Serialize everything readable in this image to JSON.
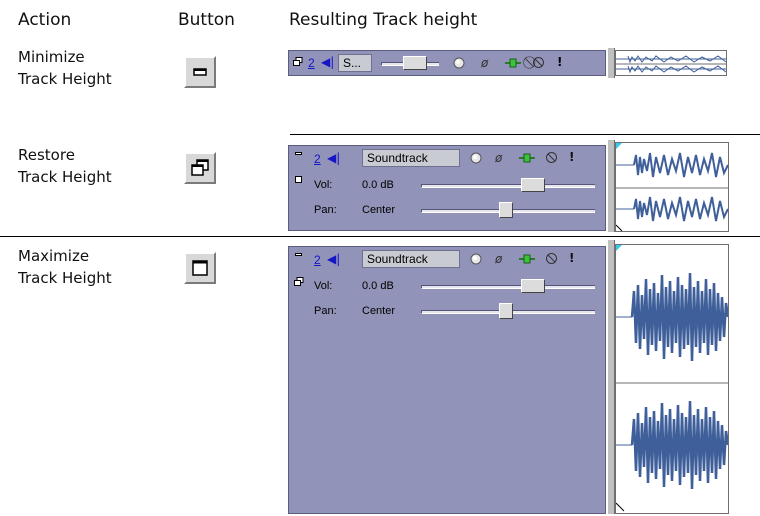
{
  "headers": {
    "action": "Action",
    "button": "Button",
    "result": "Resulting Track height"
  },
  "rows": [
    {
      "action_line1": "Minimize",
      "action_line2": "Track Height",
      "button_icon": "minimize-icon",
      "track": {
        "number": "2",
        "name": "S..."
      }
    },
    {
      "action_line1": "Restore",
      "action_line2": "Track Height",
      "button_icon": "restore-icon",
      "track": {
        "number": "2",
        "name": "Soundtrack",
        "vol_label": "Vol:",
        "vol_value": "0.0 dB",
        "pan_label": "Pan:",
        "pan_value": "Center"
      }
    },
    {
      "action_line1": "Maximize",
      "action_line2": "Track Height",
      "button_icon": "maximize-icon",
      "track": {
        "number": "2",
        "name": "Soundtrack",
        "vol_label": "Vol:",
        "vol_value": "0.0 dB",
        "pan_label": "Pan:",
        "pan_value": "Center"
      }
    }
  ],
  "colors": {
    "panel": "#9293b8",
    "waveform": "#3f5f9a",
    "track_number": "#1515c8"
  }
}
